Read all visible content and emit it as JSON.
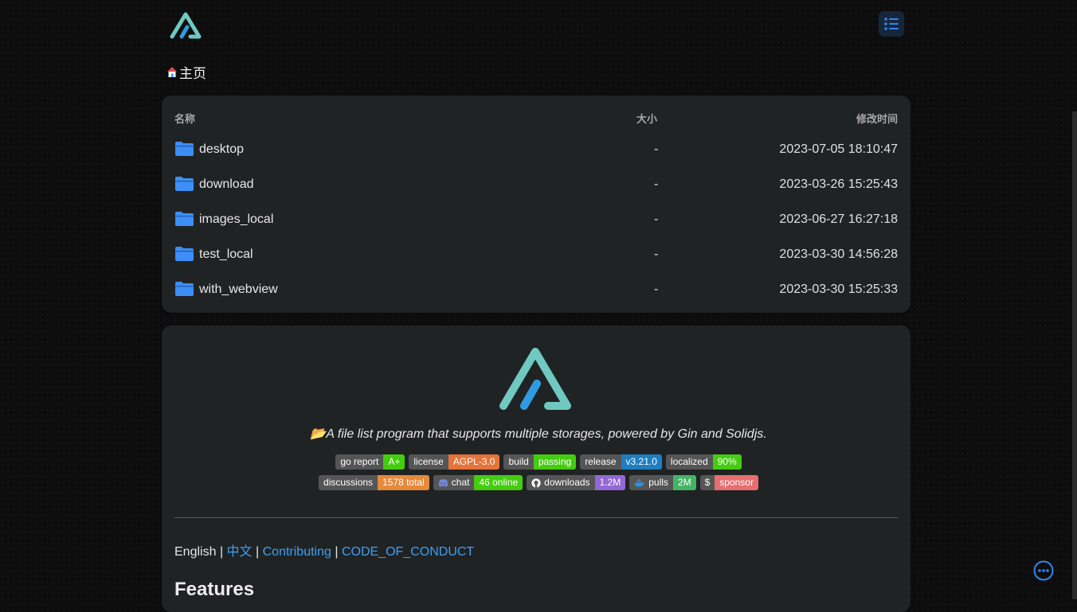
{
  "breadcrumb": {
    "home_label": "主页"
  },
  "table": {
    "headers": {
      "name": "名称",
      "size": "大小",
      "modified": "修改时间"
    },
    "rows": [
      {
        "name": "desktop",
        "size": "-",
        "modified": "2023-07-05 18:10:47"
      },
      {
        "name": "download",
        "size": "-",
        "modified": "2023-03-26 15:25:43"
      },
      {
        "name": "images_local",
        "size": "-",
        "modified": "2023-06-27 16:27:18"
      },
      {
        "name": "test_local",
        "size": "-",
        "modified": "2023-03-30 14:56:28"
      },
      {
        "name": "with_webview",
        "size": "-",
        "modified": "2023-03-30 15:25:33"
      }
    ]
  },
  "readme": {
    "tagline": "📂A file list program that supports multiple storages, powered by Gin and Solidjs.",
    "badges_row1": [
      {
        "label": "go report",
        "value": "A+",
        "color": "#4c1"
      },
      {
        "label": "license",
        "value": "AGPL-3.0",
        "color": "#e5733a"
      },
      {
        "label": "build",
        "value": "passing",
        "color": "#4c1"
      },
      {
        "label": "release",
        "value": "v3.21.0",
        "color": "#1f7ec1"
      },
      {
        "label": "localized",
        "value": "90%",
        "color": "#4c1"
      }
    ],
    "badges_row2": [
      {
        "label": "discussions",
        "value": "1578 total",
        "color": "#e5893a",
        "icon": ""
      },
      {
        "label": "chat",
        "value": "46 online",
        "color": "#4c1",
        "icon": "discord-icon"
      },
      {
        "label": "downloads",
        "value": "1.2M",
        "color": "#9467d6",
        "icon": "github-icon"
      },
      {
        "label": "pulls",
        "value": "2M",
        "color": "#44b466",
        "icon": "docker-icon"
      },
      {
        "label": "$",
        "value": "sponsor",
        "color": "#e76e70",
        "icon": ""
      }
    ],
    "links": {
      "english": "English",
      "sep": "|",
      "chinese": "中文",
      "contributing": "Contributing",
      "conduct": "CODE_OF_CONDUCT"
    },
    "features_heading": "Features"
  },
  "colors": {
    "accent": "#1e90ff",
    "folder": "#3d8ef5",
    "logo_teal": "#6fc9c0",
    "logo_blue": "#2f9be0"
  }
}
